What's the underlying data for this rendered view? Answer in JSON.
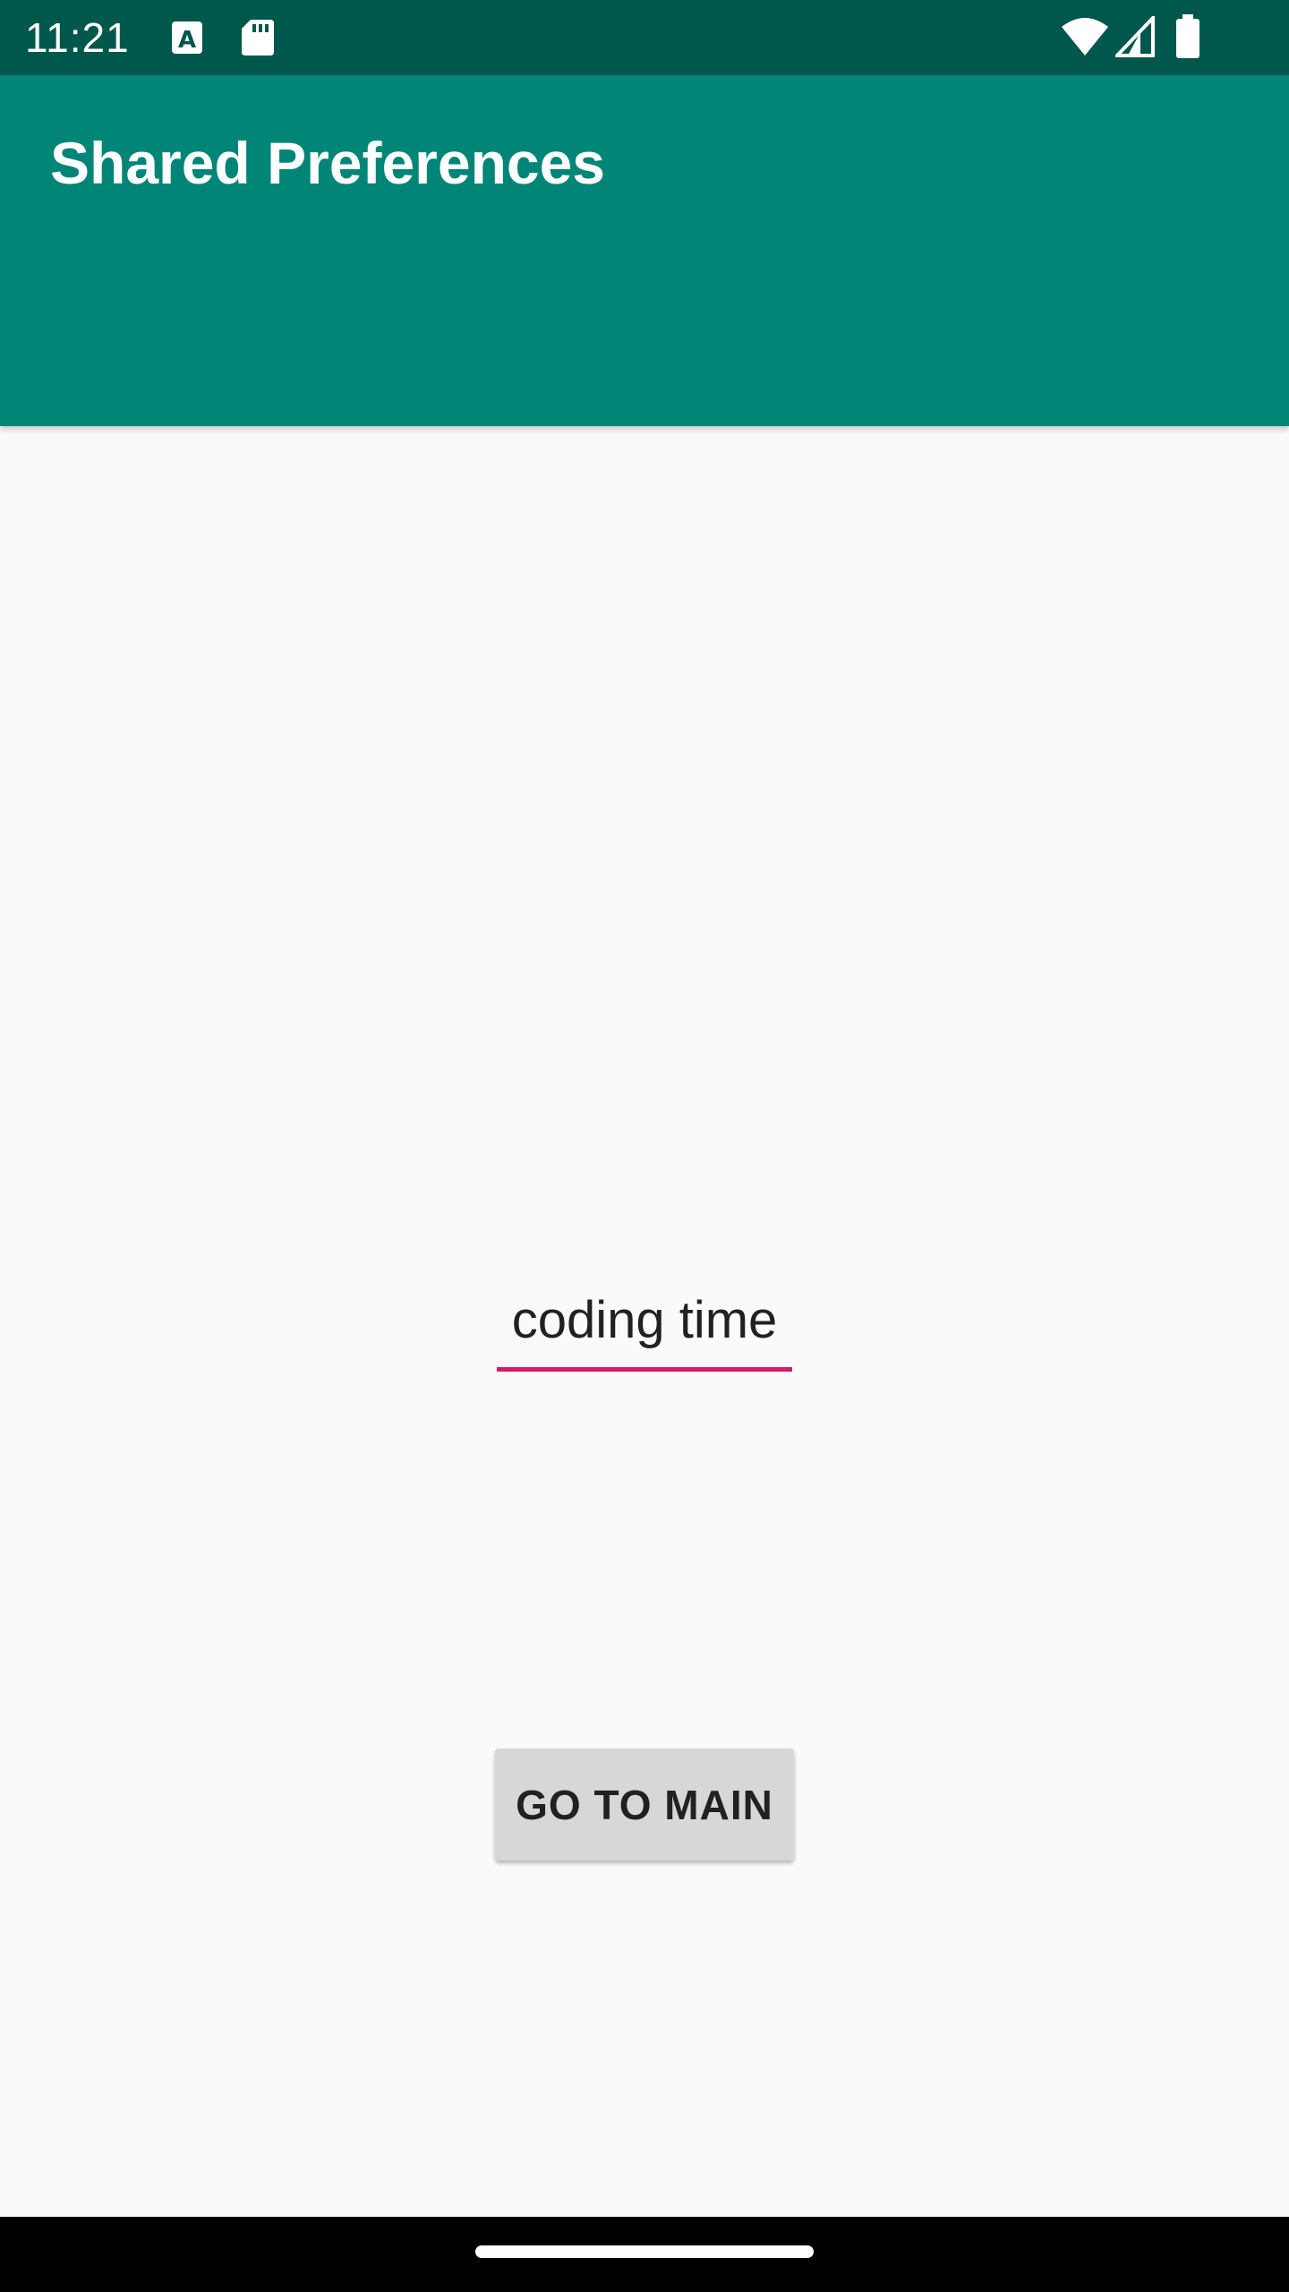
{
  "status_bar": {
    "time": "11:21",
    "icons": [
      "text-recognition-icon",
      "sd-card-icon",
      "wifi-icon",
      "cellular-signal-icon",
      "battery-icon"
    ]
  },
  "app_bar": {
    "title": "Shared Preferences"
  },
  "main": {
    "text_field_value": "coding time",
    "go_main_label": "GO TO MAIN"
  },
  "colors": {
    "status_bar": "#00574b",
    "primary": "#008577",
    "accent": "#d81b60",
    "background": "#fafafa",
    "button": "#d6d7d7"
  }
}
